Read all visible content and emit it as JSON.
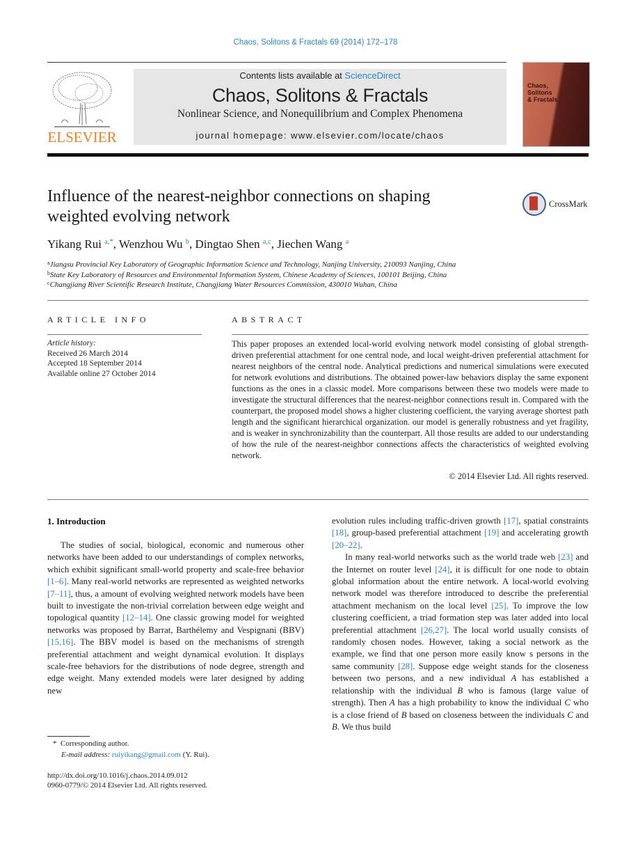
{
  "header": {
    "journal_ref": "Chaos, Solitons & Fractals 69 (2014) 172–178",
    "contents_prefix": "Contents lists available at ",
    "contents_link": "ScienceDirect",
    "journal_name": "Chaos, Solitons & Fractals",
    "journal_subtitle": "Nonlinear Science, and Nonequilibrium and Complex Phenomena",
    "homepage": "journal homepage: www.elsevier.com/locate/chaos",
    "publisher_logo_text": "ELSEVIER",
    "cover_title_lines": [
      "Chaos,",
      "Solitons",
      "& Fractals"
    ]
  },
  "article": {
    "title": "Influence of the nearest-neighbor connections on shaping weighted evolving network",
    "crossmark_label": "CrossMark",
    "authors": [
      {
        "name": "Yikang Rui",
        "sup": "a,*",
        "sep": ", "
      },
      {
        "name": "Wenzhou Wu",
        "sup": "b",
        "sep": ", "
      },
      {
        "name": "Dingtao Shen",
        "sup": "a,c",
        "sep": ", "
      },
      {
        "name": "Jiechen Wang",
        "sup": "a",
        "sep": ""
      }
    ],
    "affiliations": [
      {
        "mark": "a",
        "text": "Jiangsu Provincial Key Laboratory of Geographic Information Science and Technology, Nanjing University, 210093 Nanjing, China"
      },
      {
        "mark": "b",
        "text": "State Key Laboratory of Resources and Environmental Information System, Chinese Academy of Sciences, 100101 Beijing, China"
      },
      {
        "mark": "c",
        "text": "Changjiang River Scientific Research Institute, Changjiang Water Resources Commission, 430010 Wuhan, China"
      }
    ]
  },
  "article_info": {
    "heading": "ARTICLE INFO",
    "history_label": "Article history:",
    "received": "Received 26 March 2014",
    "accepted": "Accepted 18 September 2014",
    "online": "Available online 27 October 2014"
  },
  "abstract": {
    "heading": "ABSTRACT",
    "text": "This paper proposes an extended local-world evolving network model consisting of global strength-driven preferential attachment for one central node, and local weight-driven preferential attachment for nearest neighbors of the central node. Analytical predictions and numerical simulations were executed for network evolutions and distributions. The obtained power-law behaviors display the same exponent functions as the ones in a classic model. More comparisons between these two models were made to investigate the structural differences that the nearest-neighbor connections result in. Compared with the counterpart, the proposed model shows a higher clustering coefficient, the varying average shortest path length and the significant hierarchical organization. our model is generally robustness and yet fragility, and is weaker in synchronizability than the counterpart. All those results are added to our understanding of how the rule of the nearest-neighbor connections affects the characteristics of weighted evolving network.",
    "copyright": "© 2014 Elsevier Ltd. All rights reserved."
  },
  "body": {
    "section_heading": "1. Introduction",
    "left_column": [
      {
        "t": "The studies of social, biological, economic and numerous other networks have been added to our understandings of complex networks, which exhibit significant small-world property and scale-free behavior "
      },
      {
        "ref": "[1–6]"
      },
      {
        "t": ". Many real-world networks are represented as weighted networks "
      },
      {
        "ref": "[7–11]"
      },
      {
        "t": ", thus, a amount of evolving weighted network models have been built to investigate the non-trivial correlation between edge weight and topological quantity "
      },
      {
        "ref": "[12–14]"
      },
      {
        "t": ". One classic growing model for weighted networks was proposed by Barrat, Barthélemy and Vespignani (BBV) "
      },
      {
        "ref": "[15,16]"
      },
      {
        "t": ". The BBV model is based on the mechanisms of strength preferential attachment and weight dynamical evolution. It displays scale-free behaviors for the distributions of node degree, strength and edge weight. Many extended models were later designed by adding new"
      }
    ],
    "right_column_p1": [
      {
        "t": "evolution rules including traffic-driven growth "
      },
      {
        "ref": "[17]"
      },
      {
        "t": ", spatial constraints "
      },
      {
        "ref": "[18]"
      },
      {
        "t": ", group-based preferential attachment "
      },
      {
        "ref": "[19]"
      },
      {
        "t": " and accelerating growth "
      },
      {
        "ref": "[20–22]"
      },
      {
        "t": "."
      }
    ],
    "right_column_p2": [
      {
        "t": "In many real-world networks such as the world trade web "
      },
      {
        "ref": "[23]"
      },
      {
        "t": " and the Internet on router level "
      },
      {
        "ref": "[24]"
      },
      {
        "t": ", it is difficult for one node to obtain global information about the entire network. A local-world evolving network model was therefore introduced to describe the preferential attachment mechanism on the local level "
      },
      {
        "ref": "[25]"
      },
      {
        "t": ". To improve the low clustering coefficient, a triad formation step was later added into local preferential attachment "
      },
      {
        "ref": "[26,27]"
      },
      {
        "t": ". The local world usually consists of randomly chosen nodes. However, taking a social network as the example, we find that one person more easily know s persons in the same community "
      },
      {
        "ref": "[28]"
      },
      {
        "t": ". Suppose edge weight stands for the closeness between two persons, and a new individual "
      },
      {
        "i": "A"
      },
      {
        "t": " has established a relationship with the individual "
      },
      {
        "i": "B"
      },
      {
        "t": " who is famous (large value of strength). Then "
      },
      {
        "i": "A"
      },
      {
        "t": " has a high probability to know the individual "
      },
      {
        "i": "C"
      },
      {
        "t": " who is a close friend of "
      },
      {
        "i": "B"
      },
      {
        "t": " based on closeness between the individuals "
      },
      {
        "i": "C"
      },
      {
        "t": " and "
      },
      {
        "i": "B"
      },
      {
        "t": ". We thus build"
      }
    ]
  },
  "footnotes": {
    "corresponding_mark": "*",
    "corresponding": "Corresponding author.",
    "email_label": "E-mail address: ",
    "email": "ruiyikang@gmail.com",
    "email_suffix": " (Y. Rui).",
    "doi": "http://dx.doi.org/10.1016/j.chaos.2014.09.012",
    "issn_line": "0960-0779/© 2014 Elsevier Ltd. All rights reserved."
  }
}
